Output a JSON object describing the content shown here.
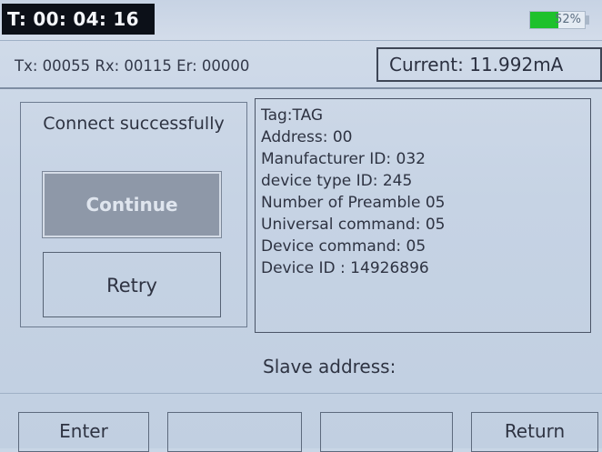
{
  "header": {
    "timer": "T: 00: 04: 16",
    "battery": {
      "label": "52%",
      "level_percent": 52,
      "fill_color": "#1ec12c"
    }
  },
  "counters": {
    "text": "Tx: 00055 Rx: 00115 Er: 00000",
    "current": "Current: 11.992mA"
  },
  "status": {
    "message": "Connect successfully",
    "continue_label": "Continue",
    "retry_label": "Retry"
  },
  "device_info": [
    "Tag:TAG",
    "Address: 00",
    "Manufacturer ID: 032",
    "device type ID: 245",
    "Number of Preamble 05",
    "Universal command: 05",
    "Device command: 05",
    "Device ID : 14926896"
  ],
  "slave": {
    "label": "Slave address:"
  },
  "softkeys": [
    "Enter",
    "",
    "",
    "Return"
  ],
  "colors": {
    "background": "#c6d3e4",
    "timer_bg": "#0c1018",
    "disabled_button": "#8e98a8"
  }
}
